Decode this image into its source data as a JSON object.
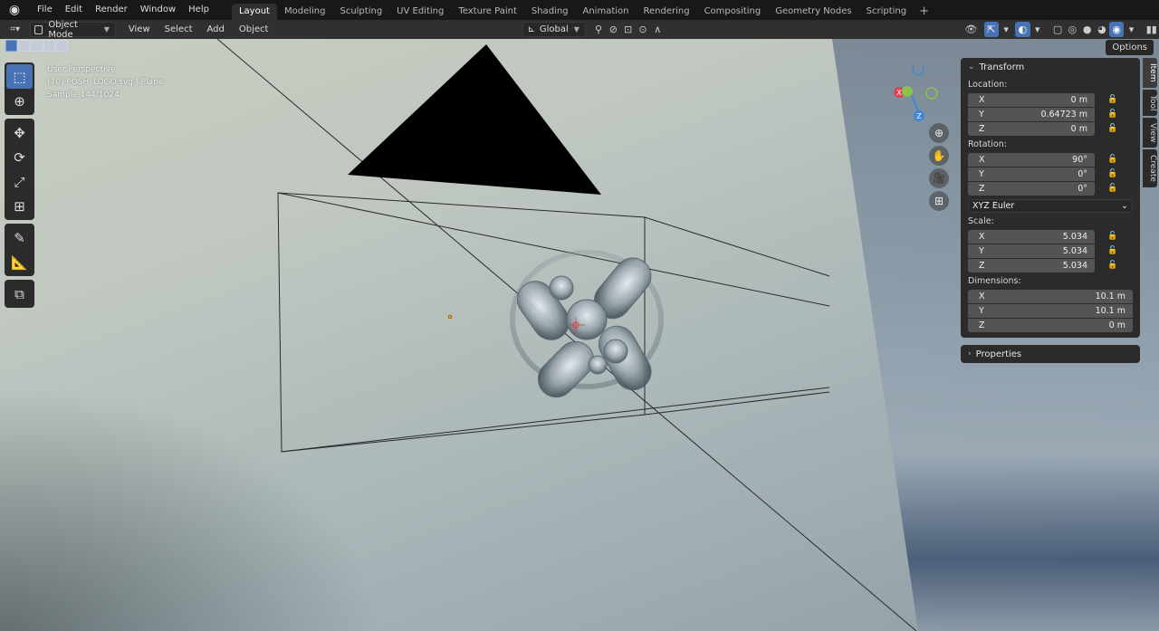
{
  "topbar": {
    "menus": [
      "File",
      "Edit",
      "Render",
      "Window",
      "Help"
    ],
    "workspaces": [
      "Layout",
      "Modeling",
      "Sculpting",
      "UV Editing",
      "Texture Paint",
      "Shading",
      "Animation",
      "Rendering",
      "Compositing",
      "Geometry Nodes",
      "Scripting"
    ],
    "active_workspace": "Layout",
    "add_tab": "+"
  },
  "header": {
    "mode": "Object Mode",
    "menus": [
      "View",
      "Select",
      "Add",
      "Object"
    ],
    "orientation": "Global",
    "options": "Options"
  },
  "viewport": {
    "overlay_lines": [
      "User Perspective",
      "(70) POSH_LOGO.svg | Plane",
      "Sample 144/1024"
    ],
    "gizmo": {
      "x": "X",
      "y": "Y",
      "z": "Z"
    }
  },
  "npanel": {
    "transform_title": "Transform",
    "location_label": "Location:",
    "location": [
      {
        "axis": "X",
        "value": "0 m"
      },
      {
        "axis": "Y",
        "value": "0.64723 m"
      },
      {
        "axis": "Z",
        "value": "0 m"
      }
    ],
    "rotation_label": "Rotation:",
    "rotation": [
      {
        "axis": "X",
        "value": "90°"
      },
      {
        "axis": "Y",
        "value": "0°"
      },
      {
        "axis": "Z",
        "value": "0°"
      }
    ],
    "rotation_mode": "XYZ Euler",
    "scale_label": "Scale:",
    "scale": [
      {
        "axis": "X",
        "value": "5.034"
      },
      {
        "axis": "Y",
        "value": "5.034"
      },
      {
        "axis": "Z",
        "value": "5.034"
      }
    ],
    "dimensions_label": "Dimensions:",
    "dimensions": [
      {
        "axis": "X",
        "value": "10.1 m"
      },
      {
        "axis": "Y",
        "value": "10.1 m"
      },
      {
        "axis": "Z",
        "value": "0 m"
      }
    ],
    "properties_title": "Properties"
  },
  "side_tabs": [
    "Item",
    "Tool",
    "View",
    "Create"
  ],
  "colors": {
    "accent": "#4772b3",
    "x_axis": "#e0424f",
    "y_axis": "#8bc34a",
    "z_axis": "#3e86d6"
  }
}
